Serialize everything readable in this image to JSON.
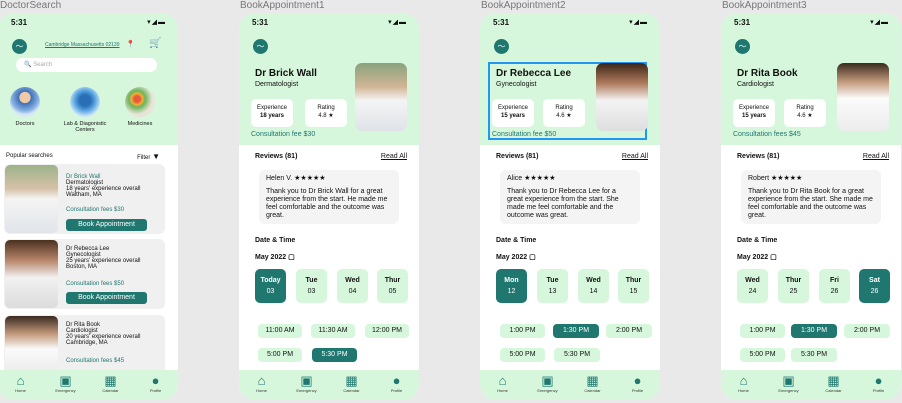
{
  "frames": [
    "DoctorSearch",
    "BookAppointment1",
    "BookAppointment2",
    "BookAppointment3"
  ],
  "status": {
    "time": "5:31",
    "icons": "▾◢▬"
  },
  "nav": [
    "Home",
    "Emergency",
    "Calendar",
    "Profile"
  ],
  "search": {
    "location": "Cambridge Massachusetts 02139",
    "placeholder": "Search",
    "popular": "Popular searches",
    "filter": "Filter"
  },
  "categories": [
    "Doctors",
    "Lab & Diagonistic Centers",
    "Medicines"
  ],
  "doctors": [
    {
      "name": "Dr Brick Wall",
      "spec": "Dermatologist",
      "exp": "18 years' experience overall",
      "loc": "Waltham, MA",
      "fee": "Consultation fees $30",
      "btn": "Book Appointment"
    },
    {
      "name": "Dr Rebecca Lee",
      "spec": "Gynecologist",
      "exp": "25 years' experience overall",
      "loc": "Boston, MA",
      "fee": "Consultation fees $50",
      "btn": "Book Appointment"
    },
    {
      "name": "Dr Rita Book",
      "spec": "Cardiologist",
      "exp": "20 years' experience overall",
      "loc": "Cambridge, MA",
      "fee": "Consultation fees $45"
    }
  ],
  "b1": {
    "name": "Dr Brick Wall",
    "spec": "Dermatologist",
    "expl": "Experience",
    "expv": "18 years",
    "ratl": "Rating",
    "ratv": "4.8 ★",
    "fee": "Consultation fee   $30",
    "reviews": "Reviews (81)",
    "readall": "Read All",
    "rname": "Helen V. ★★★★★",
    "rtext": "Thank you to Dr Brick Wall for a great experience from the start. He made me feel comfortable and the outcome was great.",
    "dt": "Date & Time",
    "month": "May 2022",
    "days": [
      {
        "n": "Today",
        "d": "03"
      },
      {
        "n": "Tue",
        "d": "03"
      },
      {
        "n": "Wed",
        "d": "04"
      },
      {
        "n": "Thur",
        "d": "05"
      }
    ],
    "slots": [
      "11:00 AM",
      "11:30 AM",
      "12:00 PM",
      "5:00 PM",
      "5:30 PM"
    ]
  },
  "b2": {
    "name": "Dr Rebecca Lee",
    "spec": "Gynecologist",
    "expl": "Experience",
    "expv": "15 years",
    "ratl": "Rating",
    "ratv": "4.6 ★",
    "fee": "Consultation fee   $50",
    "reviews": "Reviews (81)",
    "readall": "Read All",
    "rname": "Alice ★★★★★",
    "rtext": "Thank you to Dr Rebecca Lee for a great experience from the start. She made me feel comfortable and the outcome was great.",
    "dt": "Date & Time",
    "month": "May 2022",
    "days": [
      {
        "n": "Mon",
        "d": "12"
      },
      {
        "n": "Tue",
        "d": "13"
      },
      {
        "n": "Wed",
        "d": "14"
      },
      {
        "n": "Thur",
        "d": "15"
      }
    ],
    "slots": [
      "1:00 PM",
      "1:30 PM",
      "2:00 PM",
      "5:00 PM",
      "5:30 PM"
    ]
  },
  "b3": {
    "name": "Dr Rita Book",
    "spec": "Cardiologist",
    "expl": "Experience",
    "expv": "15 years",
    "ratl": "Rating",
    "ratv": "4.6 ★",
    "fee": "Consultation fees   $45",
    "reviews": "Reviews (81)",
    "readall": "Read All",
    "rname": "Robert ★★★★★",
    "rtext": "Thank you to Dr Rita Book for a great experience from the start. She made me feel comfortable and the outcome was great.",
    "dt": "Date & Time",
    "month": "May 2022",
    "days": [
      {
        "n": "Wed",
        "d": "24"
      },
      {
        "n": "Thur",
        "d": "25"
      },
      {
        "n": "Fri",
        "d": "26"
      },
      {
        "n": "Sat",
        "d": "26"
      }
    ],
    "slots": [
      "1:00 PM",
      "1:30 PM",
      "2:00 PM",
      "5:00 PM",
      "5:30 PM"
    ]
  },
  "colors": {
    "accent": "#1f7770",
    "mint": "#d6f7dc",
    "highlight": "#2196f3"
  }
}
